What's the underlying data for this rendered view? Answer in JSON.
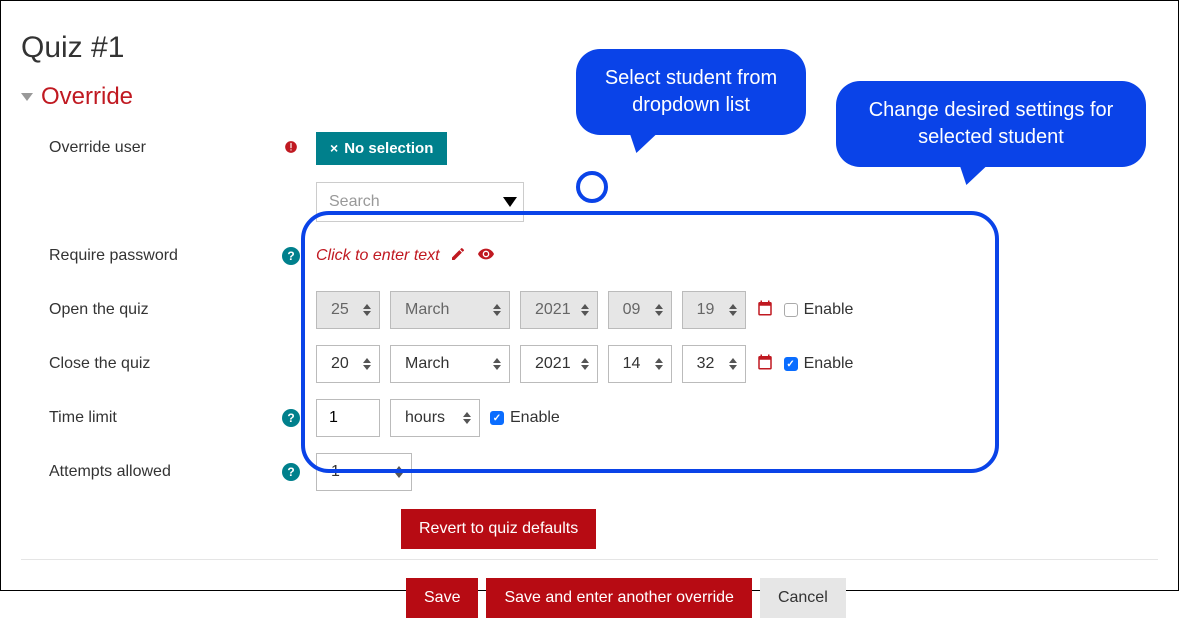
{
  "page_title": "Quiz #1",
  "section_title": "Override",
  "fields": {
    "override_user": {
      "label": "Override user",
      "chip_label": "No selection",
      "search_placeholder": "Search"
    },
    "require_password": {
      "label": "Require password",
      "placeholder_text": "Click to enter text"
    },
    "open_quiz": {
      "label": "Open the quiz",
      "day": "25",
      "month": "March",
      "year": "2021",
      "hour": "09",
      "minute": "19",
      "enable_label": "Enable",
      "enabled": false
    },
    "close_quiz": {
      "label": "Close the quiz",
      "day": "20",
      "month": "March",
      "year": "2021",
      "hour": "14",
      "minute": "32",
      "enable_label": "Enable",
      "enabled": true
    },
    "time_limit": {
      "label": "Time limit",
      "value": "1",
      "unit": "hours",
      "enable_label": "Enable",
      "enabled": true
    },
    "attempts": {
      "label": "Attempts allowed",
      "value": "1"
    }
  },
  "buttons": {
    "revert": "Revert to quiz defaults",
    "save": "Save",
    "save_another": "Save and enter another override",
    "cancel": "Cancel"
  },
  "annotations": {
    "callout1": "Select student from dropdown list",
    "callout2": "Change desired settings for selected student"
  }
}
